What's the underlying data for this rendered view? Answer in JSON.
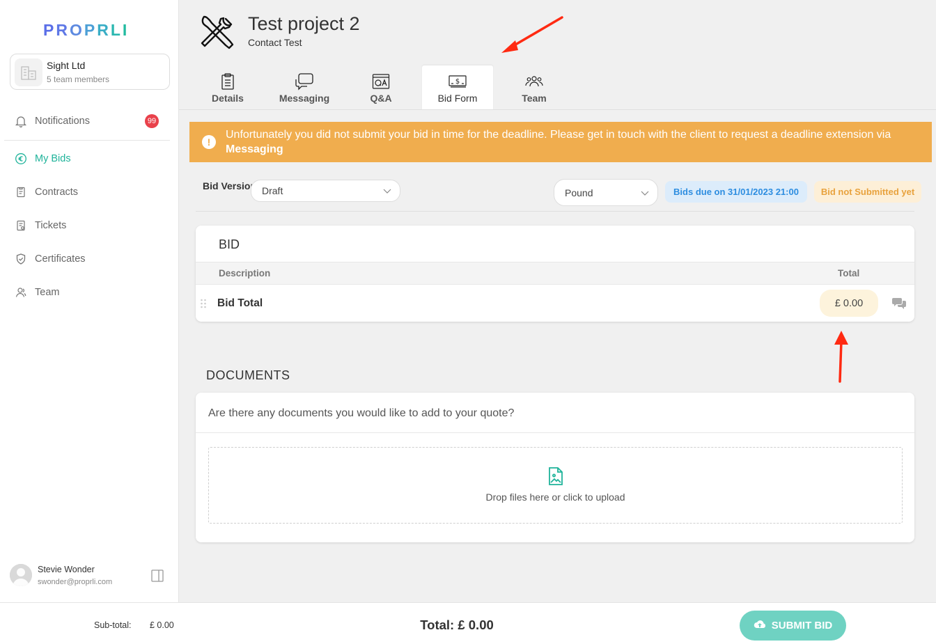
{
  "brand": {
    "logo_letters": [
      "P",
      "R",
      "O",
      "P",
      "R",
      "L",
      "I"
    ],
    "logo_colors": [
      "#5a6ee8",
      "#5f78e6",
      "#5e8ae0",
      "#4c9fd6",
      "#3aaec6",
      "#2bb7b0",
      "#22bba0"
    ]
  },
  "company": {
    "name": "Sight Ltd",
    "members": "5 team members"
  },
  "nav": {
    "notifications": {
      "label": "Notifications",
      "badge": "99"
    },
    "my_bids": {
      "label": "My Bids"
    },
    "contracts": {
      "label": "Contracts"
    },
    "tickets": {
      "label": "Tickets"
    },
    "certificates": {
      "label": "Certificates"
    },
    "team": {
      "label": "Team"
    }
  },
  "user": {
    "name": "Stevie Wonder",
    "email": "swonder@proprli.com"
  },
  "project": {
    "title": "Test project 2",
    "subtitle": "Contact Test"
  },
  "tabs": [
    {
      "label": "Details",
      "icon": "clipboard-icon"
    },
    {
      "label": "Messaging",
      "icon": "chat-bubbles-icon"
    },
    {
      "label": "Q&A",
      "icon": "qa-icon"
    },
    {
      "label": "Bid Form",
      "icon": "banknote-icon",
      "active": true
    },
    {
      "label": "Team",
      "icon": "people-icon"
    }
  ],
  "alert": {
    "text": "Unfortunately you did not submit your bid in time for the deadline. Please get in touch with the client to request a deadline extension via ",
    "link": "Messaging"
  },
  "bid_version": {
    "label": "Bid Version:",
    "value": "Draft"
  },
  "currency": {
    "value": "Pound"
  },
  "status": {
    "due": "Bids due on 31/01/2023 21:00",
    "submitted": "Bid not Submitted yet"
  },
  "bid": {
    "title": "BID",
    "col_description": "Description",
    "col_total": "Total",
    "row_label": "Bid Total",
    "row_amount": "£ 0.00"
  },
  "documents": {
    "title": "DOCUMENTS",
    "question": "Are there any documents you would like to add to your quote?",
    "drop_text": "Drop files here or click to upload"
  },
  "footer": {
    "subtotal_label": "Sub-total:",
    "subtotal_value": "£ 0.00",
    "total": "Total: £ 0.00",
    "submit_label": "SUBMIT BID"
  },
  "colors": {
    "accent": "#1fb39a",
    "alert": "#f0ad4e",
    "annotation": "#ff2a12"
  }
}
